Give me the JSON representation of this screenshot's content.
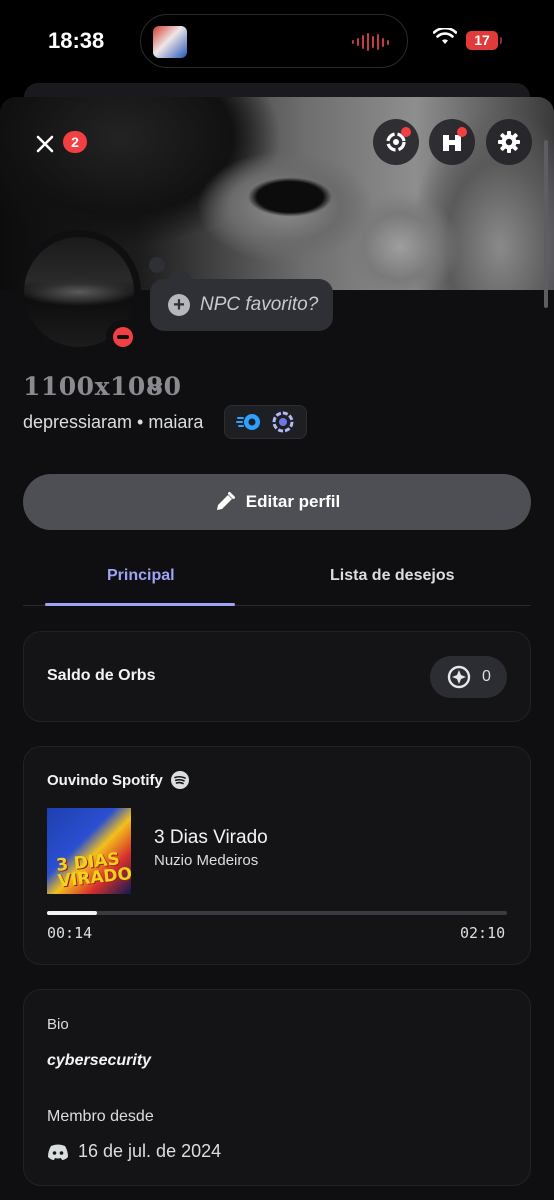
{
  "status_bar": {
    "time": "18:38",
    "battery": "17"
  },
  "header": {
    "notification_count": "2"
  },
  "profile": {
    "custom_status": "NPC favorito?",
    "display_name": "1100x1080",
    "handle_line": "depressiaram • maiara",
    "edit_label": "Editar perfil"
  },
  "tabs": [
    {
      "label": "Principal"
    },
    {
      "label": "Lista de desejos"
    }
  ],
  "orbs": {
    "label": "Saldo de Orbs",
    "value": "0"
  },
  "spotify": {
    "label": "Ouvindo Spotify",
    "track": "3 Dias Virado",
    "artist": "Nuzio Medeiros",
    "cover_text": "3 DIAS VIRADO",
    "elapsed": "00:14",
    "duration": "02:10",
    "progress": 0.108
  },
  "bio": {
    "heading": "Bio",
    "text": "cybersecurity"
  },
  "member_since": {
    "heading": "Membro desde",
    "date": "16 de jul. de 2024"
  },
  "colors": {
    "accent": "#9ea3f5",
    "danger": "#f23f42",
    "card": "#141416"
  },
  "icons": [
    "close-icon",
    "quest-icon",
    "shop-icon",
    "gear-icon",
    "pencil-icon",
    "nitro-icon",
    "orb-icon",
    "spotify-icon",
    "discord-icon"
  ]
}
